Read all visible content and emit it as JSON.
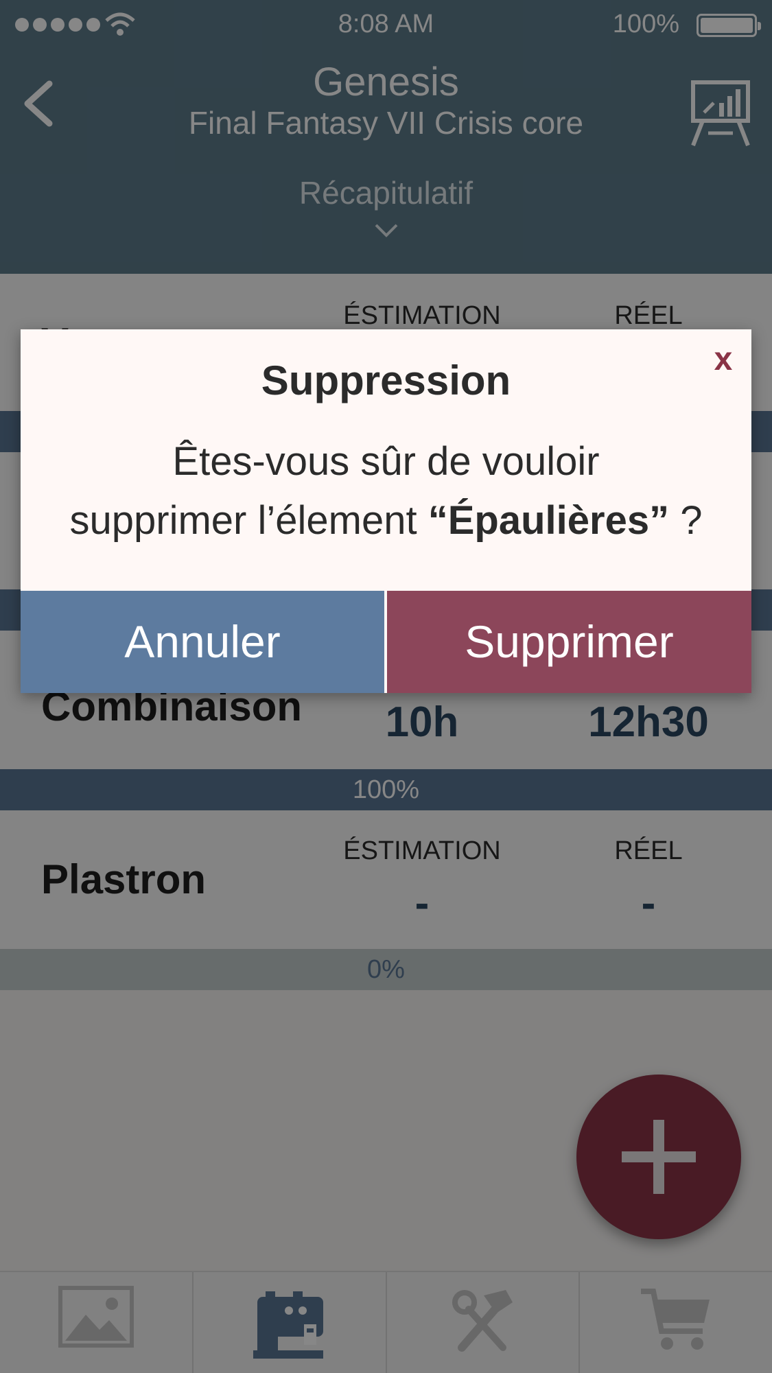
{
  "status_bar": {
    "time": "8:08 AM",
    "battery": "100%"
  },
  "header": {
    "title": "Genesis",
    "subtitle": "Final Fantasy VII Crisis core",
    "section": "Récapitulatif"
  },
  "columns": {
    "estimation": "ÉSTIMATION",
    "real": "RÉEL"
  },
  "items": [
    {
      "name": "Veste",
      "estimation": "",
      "real": ""
    },
    {
      "name": "Combinaison",
      "estimation": "10h",
      "real": "12h30",
      "progress": "100%"
    },
    {
      "name": "Plastron",
      "estimation": "-",
      "real": "-",
      "progress": "0%"
    }
  ],
  "dialog": {
    "close": "x",
    "title": "Suppression",
    "message_line1": "Êtes-vous sûr de vouloir",
    "message_line2_prefix": "supprimer l’élement ",
    "item_name": "“Épaulières”",
    "message_suffix": " ?",
    "cancel_label": "Annuler",
    "delete_label": "Supprimer"
  },
  "colors": {
    "header": "#5d7b8b",
    "accent": "#8a3346",
    "progress_full": "#5a7594",
    "progress_empty": "#c3cccd",
    "value_text": "#2b4761"
  },
  "icons": {
    "back": "chevron-left-icon",
    "stats": "presentation-chart-icon",
    "expand": "chevron-down-icon",
    "fab": "plus-icon",
    "tabs": [
      "image-icon",
      "sewing-machine-icon",
      "tools-icon",
      "cart-icon"
    ]
  }
}
